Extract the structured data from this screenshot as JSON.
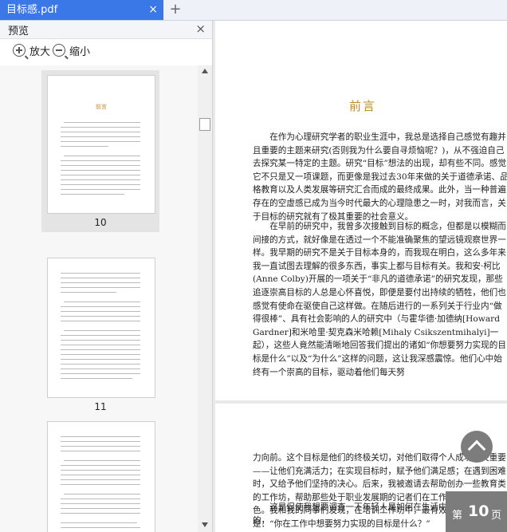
{
  "tab": {
    "title": "目标感.pdf",
    "close": "×"
  },
  "new_tab": "+",
  "sidebar": {
    "title": "预览",
    "close": "×",
    "zoom_in": "放大",
    "zoom_out": "缩小",
    "thumbnails": [
      {
        "page": "10",
        "heading": "前言",
        "selected": true
      },
      {
        "page": "11",
        "heading": "",
        "selected": false
      },
      {
        "page": "",
        "heading": "",
        "selected": false
      }
    ]
  },
  "document": {
    "heading": "前言",
    "paragraphs": [
      "在作为心理研究学者的职业生涯中，我总是选择自己感觉有趣并且重要的主题来研究(否则我为什么要自寻烦恼呢？)，从不强迫自己去探究某一特定的主题。研究“目标”想法的出现，却有些不同。感觉它不只是又一项课题，而更像是我过去30年来做的关于道德承诺、品格教育以及人类发展等研究汇合而成的最终成果。此外，当一种普遍存在的空虚感已成为当今时代最大的心理隐患之一时，对我而言，关于目标的研究就有了极其重要的社会意义。",
      "在早前的研究中，我曾多次接触到目标的概念，但都是以模糊而间接的方式，就好像是在透过一个不能准确聚焦的望远镜观察世界一样。我早期的研究不是关于目标本身的，而我现在明白，这么多年来我一直试图去理解的很多东西，事实上都与目标有关。我和安·柯比(Anne Colby)开展的一项关于“非凡的道德承诺”的研究发现，那些追逐崇高目标的人总是心怀喜悦，即便是要付出持续的牺牲，他们也感觉有使命在驱使自己这样做。在随后进行的一系列关于行业内“做得很棒”、具有社会影响的人的研究中（与霍华德·加德纳[Howard Gardner]和米哈里·契克森米哈赖[Mihaly Csikszentmihalyi]一起），这些人竟然能清晰地回答我们提出的诸如“你想要努力实现的目标是什么”以及“为什么”这样的问题，这让我深感震惊。他们心中始终有一个崇高的目标，驱动着他们每天努",
      "力向前。这个目标是他们的终极关切，对他们取得个人成功至关重要——让他们充满活力；在实现目标时，赋予他们满足感；在遇到困难时，又给予他们坚持的决心。后来，我被邀请去帮助创办一些教育类的工作坊，帮助那些处于职业发展期的记者们在工作中表现得更加出色。我和我的同事们发现，在培训工作坊中，最有效的开场白是：“你在工作中想要努力实现的目标是什么？”",
      "这是促使我想要调查一下年轻人是如何在生活中寻找他们的目标的，"
    ]
  },
  "page_indicator": {
    "prefix": "第",
    "number": "10",
    "suffix": "页"
  }
}
